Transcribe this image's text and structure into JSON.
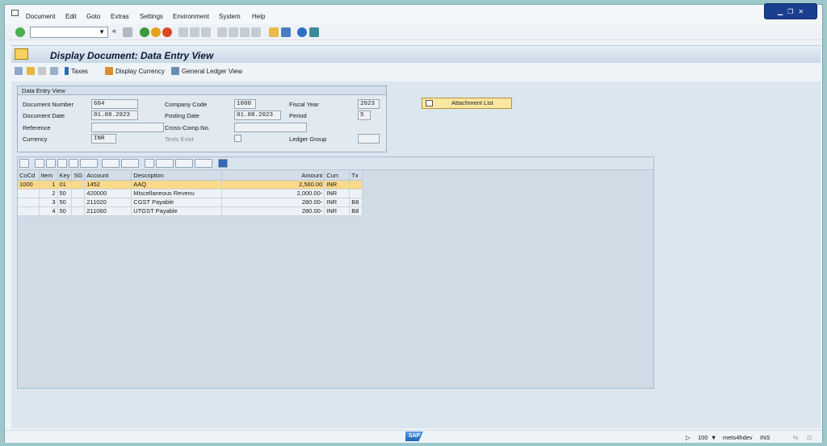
{
  "menu": [
    "Document",
    "Edit",
    "Goto",
    "Extras",
    "Settings",
    "Environment",
    "System",
    "Help"
  ],
  "title": "Display Document: Data Entry View",
  "app_toolbar": {
    "taxes": "Taxes",
    "display_currency": "Display Currency",
    "general_ledger_view": "General Ledger View"
  },
  "entry_view": {
    "title": "Data Entry View",
    "document_number_label": "Document Number",
    "document_number": "604",
    "company_code_label": "Company Code",
    "company_code": "1000",
    "fiscal_year_label": "Fiscal Year",
    "fiscal_year": "2023",
    "document_date_label": "Document Date",
    "document_date": "01.08.2023",
    "posting_date_label": "Posting Date",
    "posting_date": "01.08.2023",
    "period_label": "Period",
    "period": "5",
    "reference_label": "Reference",
    "reference": "",
    "cross_comp_label": "Cross-Comp.No.",
    "cross_comp": "",
    "currency_label": "Currency",
    "currency": "INR",
    "texts_exist_label": "Texts Exist",
    "ledger_group_label": "Ledger Group",
    "ledger_group": ""
  },
  "attachment_list": "Attachment List",
  "table": {
    "headers": [
      "CoCd",
      "Item",
      "Key",
      "SG",
      "Account",
      "Description",
      "Amount",
      "Curr.",
      "Tx"
    ],
    "rows": [
      {
        "cocd": "1000",
        "item": "1",
        "key": "01",
        "sg": "",
        "account": "1452",
        "description": "AAQ",
        "amount": "2,560.00",
        "curr": "INR",
        "tx": ""
      },
      {
        "cocd": "",
        "item": "2",
        "key": "50",
        "sg": "",
        "account": "420000",
        "description": "Miscellaneous Revenu",
        "amount": "2,000.00-",
        "curr": "INR",
        "tx": ""
      },
      {
        "cocd": "",
        "item": "3",
        "key": "50",
        "sg": "",
        "account": "211020",
        "description": "CGST Payable",
        "amount": "280.00-",
        "curr": "INR",
        "tx": "B8"
      },
      {
        "cocd": "",
        "item": "4",
        "key": "50",
        "sg": "",
        "account": "211060",
        "description": "UTGST Payable",
        "amount": "280.00-",
        "curr": "INR",
        "tx": "B8"
      }
    ]
  },
  "status": {
    "sap_logo": "SAP",
    "zoom": "100",
    "system": "mets4hdev",
    "mode": "INS"
  },
  "colors": {
    "selected_row": "#fbd98a",
    "window_button": "#1a3f8f",
    "attachment_button": "#fbe7a1"
  }
}
